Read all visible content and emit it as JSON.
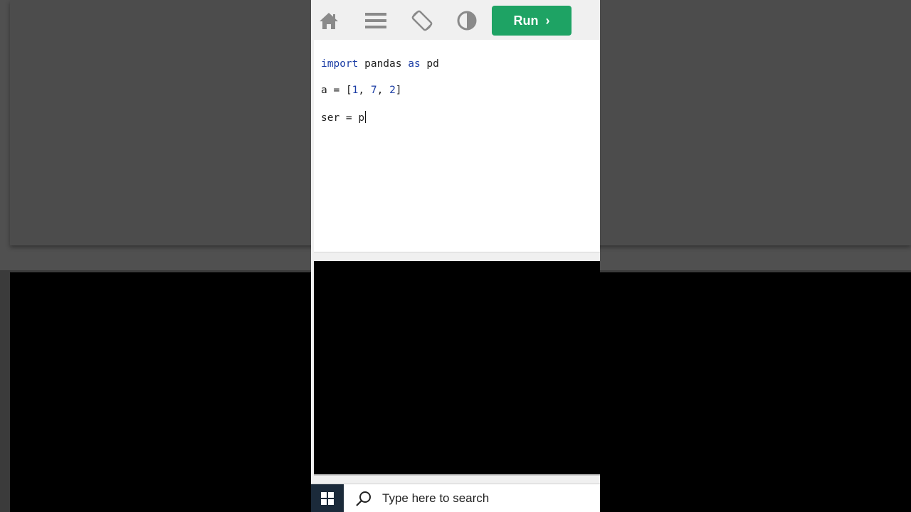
{
  "toolbar": {
    "icons": [
      "home-icon",
      "menu-icon",
      "rotate-screen-icon",
      "contrast-icon"
    ],
    "run_label": "Run",
    "run_chevron": "›"
  },
  "editor": {
    "line1": {
      "kw1": "import",
      "t1": " pandas ",
      "kw2": "as",
      "t2": " pd"
    },
    "line2": {
      "t1": "a = [",
      "n1": "1",
      "s1": ", ",
      "n2": "7",
      "s2": ", ",
      "n3": "2",
      "t2": "]"
    },
    "line3": {
      "t1": "ser = p"
    }
  },
  "taskbar": {
    "search_placeholder": "Type here to search"
  },
  "colors": {
    "run_button": "#1ea364",
    "keyword": "#1b3da5",
    "output_bg": "#000000"
  }
}
